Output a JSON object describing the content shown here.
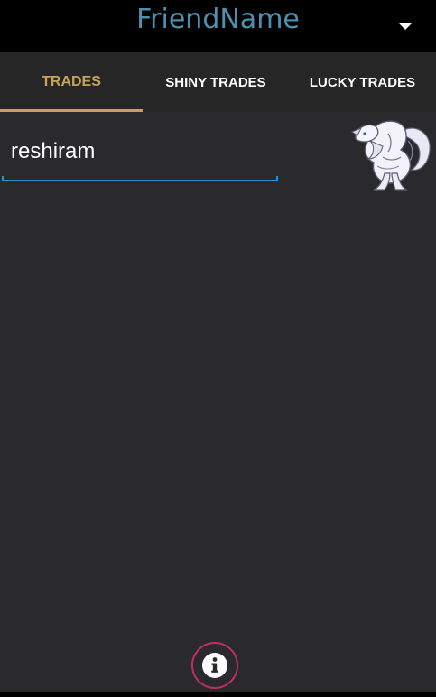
{
  "header": {
    "title": "FriendName",
    "dropdown_icon": "caret-down-icon"
  },
  "tabs": [
    {
      "label": "TRADES",
      "active": true
    },
    {
      "label": "SHINY TRADES",
      "active": false
    },
    {
      "label": "LUCKY TRADES",
      "active": false
    }
  ],
  "search": {
    "value": "reshiram",
    "placeholder": ""
  },
  "sprite": {
    "icon": "reshiram-sprite"
  },
  "footer": {
    "info_icon": "info-icon"
  },
  "colors": {
    "header_background": "#000000",
    "title": "#4d8fae",
    "tab_active": "#c7a35a",
    "tab_inactive": "#ffffff",
    "content_background": "#2a2a2c",
    "input_underline": "#2f8ed0",
    "info_ring": "#c0305f"
  }
}
